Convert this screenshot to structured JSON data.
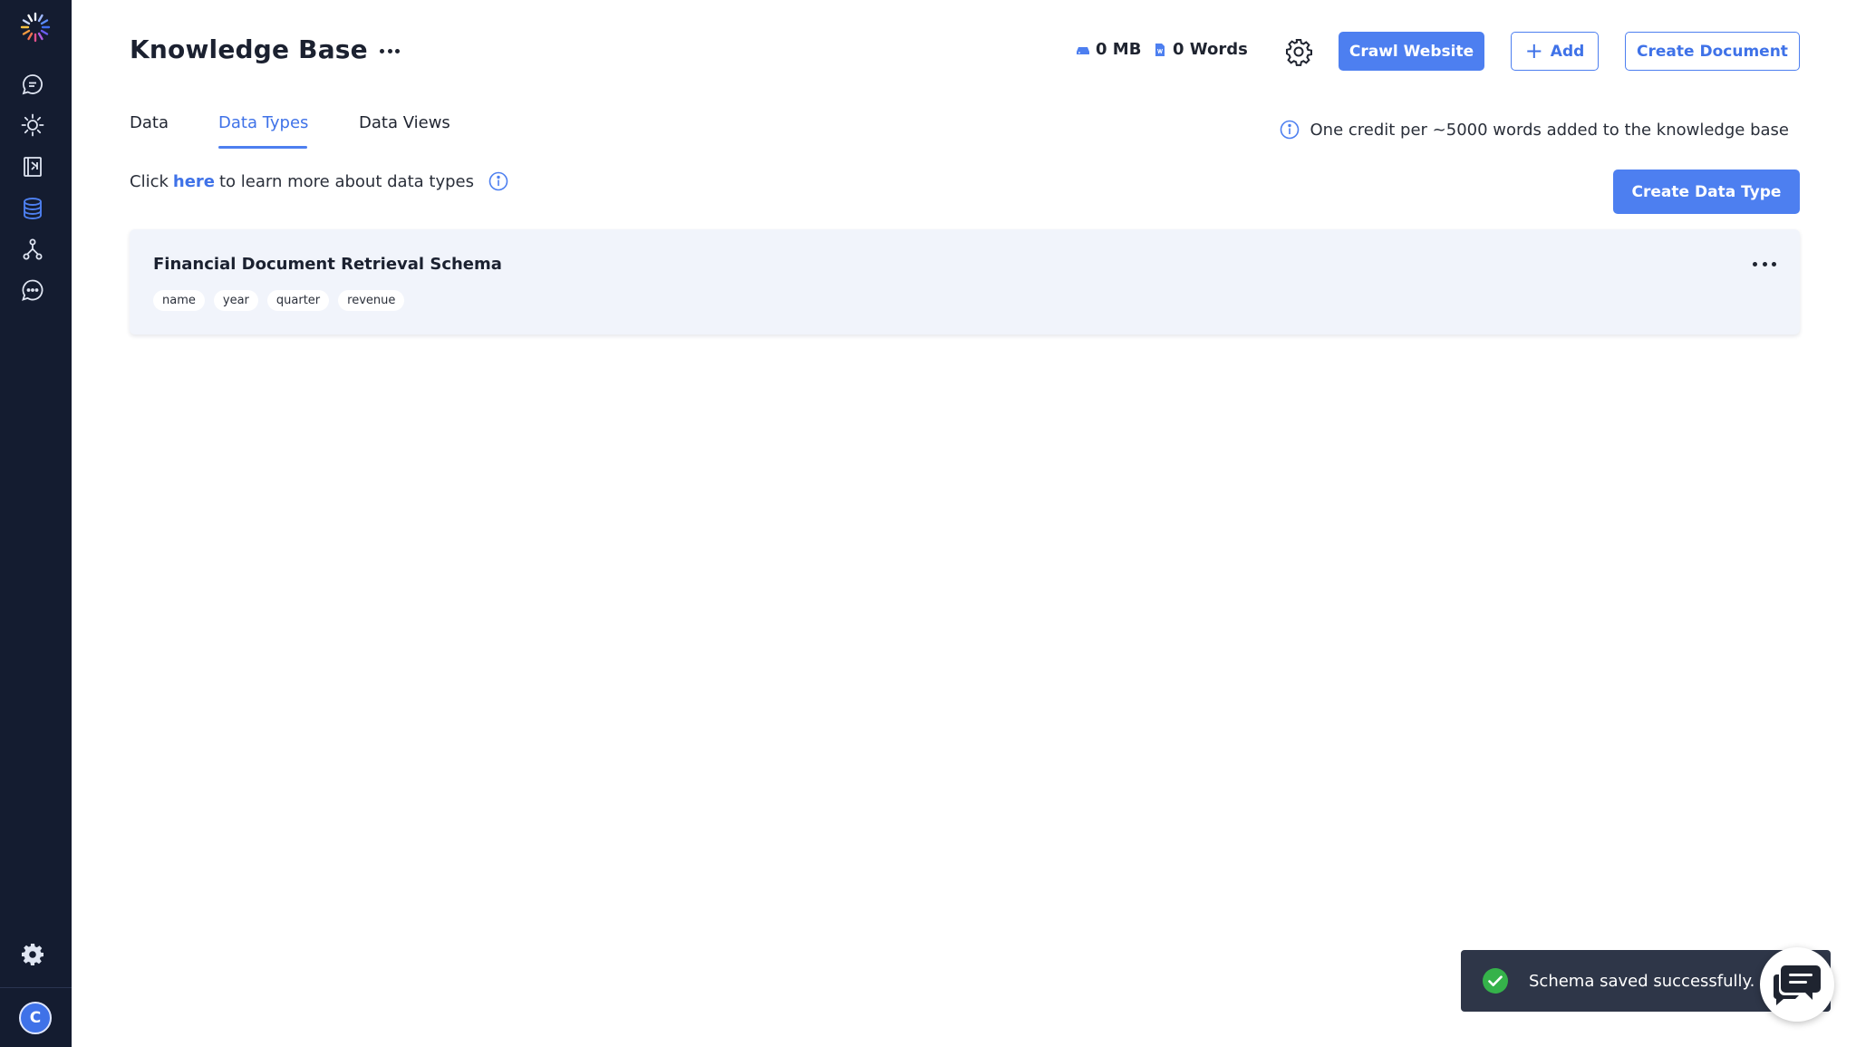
{
  "header": {
    "title": "Knowledge Base",
    "storage": "0 MB",
    "words": "0 Words",
    "crawl_label": "Crawl Website",
    "add_label": "Add",
    "create_document_label": "Create Document"
  },
  "tabs": [
    {
      "label": "Data",
      "active": false
    },
    {
      "label": "Data Types",
      "active": true
    },
    {
      "label": "Data Views",
      "active": false
    }
  ],
  "credit_note": "One credit per ~5000 words added to the knowledge base",
  "learn_more": {
    "prefix": "Click",
    "link": "here",
    "suffix": "to learn more about data types"
  },
  "create_data_type_label": "Create Data Type",
  "schema_card": {
    "title": "Financial Document Retrieval Schema",
    "tags": [
      "name",
      "year",
      "quarter",
      "revenue"
    ]
  },
  "toast": {
    "message": "Schema saved successfully."
  },
  "user": {
    "initial": "C"
  },
  "sidebar": {
    "items": [
      {
        "icon": "chat-icon",
        "active": false
      },
      {
        "icon": "sun-icon",
        "active": false
      },
      {
        "icon": "book-icon",
        "active": false
      },
      {
        "icon": "database-icon",
        "active": true
      },
      {
        "icon": "flow-icon",
        "active": false
      },
      {
        "icon": "message-dots-icon",
        "active": false
      }
    ],
    "settings_icon": "gear-icon"
  },
  "colors": {
    "sidebar_bg": "#141c30",
    "accent": "#4d7ff0",
    "toast_bg": "#2e3648",
    "success": "#35b24a"
  }
}
